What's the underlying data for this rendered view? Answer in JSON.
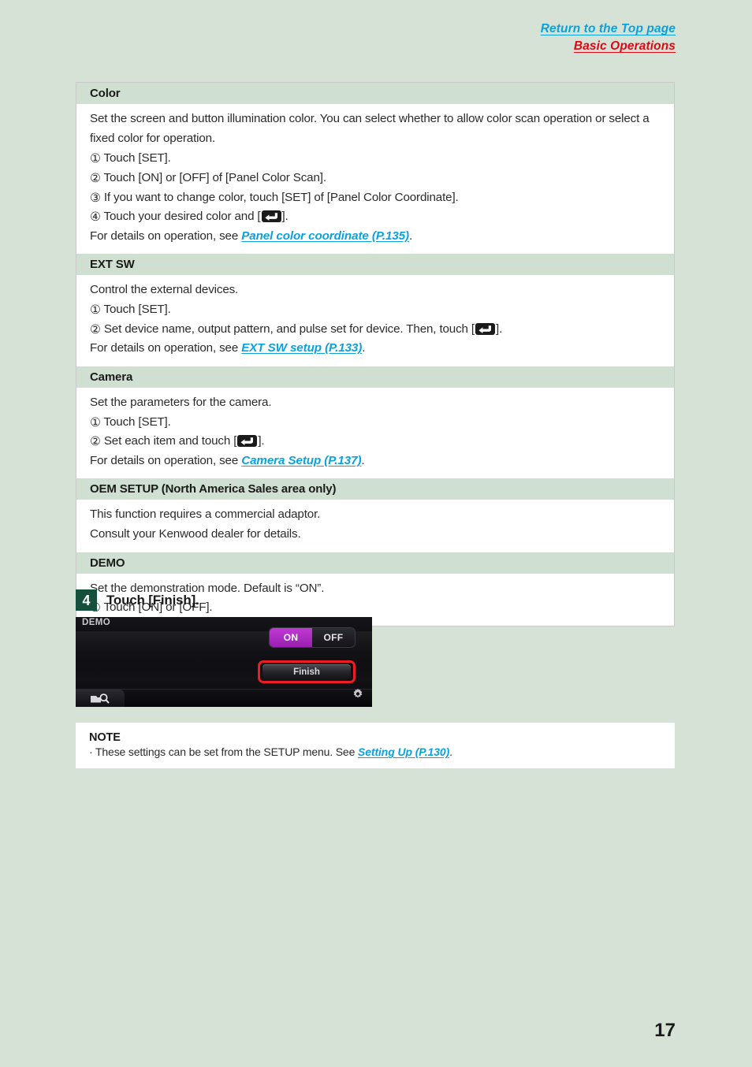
{
  "header": {
    "return_link": "Return to the Top page",
    "section_link": "Basic Operations"
  },
  "sections": [
    {
      "id": "color",
      "title": "Color",
      "lines": [
        "Set the screen and button illumination color. You can select whether to allow color scan operation or select a fixed color for operation.",
        "Touch [SET].",
        "Touch [ON] or [OFF] of [Panel Color Scan].",
        "If you want to change color, touch [SET] of [Panel Color Coordinate].",
        "Touch your desired color and [",
        "For details on operation, see ",
        "Panel color coordinate (P.135)"
      ]
    },
    {
      "id": "extsw",
      "title": "EXT SW",
      "lines": [
        "Control the external devices.",
        "Touch [SET].",
        "Set device name, output pattern, and pulse set for device. Then, touch [",
        "For details on operation, see ",
        "EXT SW setup (P.133)"
      ]
    },
    {
      "id": "camera",
      "title": "Camera",
      "lines": [
        "Set the parameters for the camera.",
        "Touch [SET].",
        "Set each item and touch [",
        "For details on operation, see ",
        "Camera Setup (P.137)"
      ]
    },
    {
      "id": "oem",
      "title": "OEM SETUP (North America Sales area only)",
      "lines": [
        "This function requires a commercial adaptor.",
        "Consult your Kenwood dealer for details."
      ]
    },
    {
      "id": "demo",
      "title": "DEMO",
      "lines": [
        "Set the demonstration mode. Default is “ON”.",
        "Touch [ON] or [OFF]."
      ]
    }
  ],
  "markers": {
    "one": "①",
    "two": "②",
    "three": "③",
    "four": "④",
    "bullet": "·",
    "close_bracket": "].",
    "period": "."
  },
  "step": {
    "number": "4",
    "text": "Touch [Finish]."
  },
  "device": {
    "title": "DEMO",
    "toggle_on": "ON",
    "toggle_off": "OFF",
    "finish_label": "Finish"
  },
  "note": {
    "title": "NOTE",
    "bullet": "·",
    "text_before": "These settings can be set from the SETUP menu. See ",
    "link": "Setting Up (P.130)",
    "text_after": "."
  },
  "page_number": "17",
  "colors": {
    "page_background": "#d6e2d6",
    "section_header": "#cfe0d2",
    "link_blue": "#0aa2dd",
    "link_red": "#e30613",
    "step_badge": "#15503d",
    "highlight_red": "#ee1c25",
    "toggle_on": "#b82ecb"
  }
}
